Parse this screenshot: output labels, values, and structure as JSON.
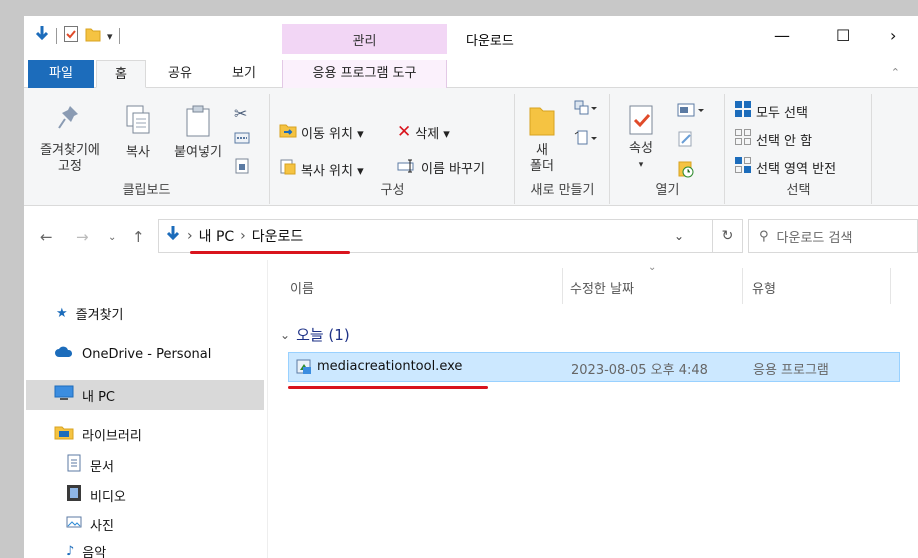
{
  "titlebar": {
    "title": "다운로드",
    "context_group": "관리",
    "minimize": "—",
    "maximize": "☐",
    "close_partial": "›"
  },
  "tabs": {
    "file": "파일",
    "home": "홈",
    "share": "공유",
    "view": "보기",
    "app_tools": "응용 프로그램 도구"
  },
  "ribbon": {
    "clipboard": {
      "pin": "즐겨찾기에\n고정",
      "copy": "복사",
      "paste": "붙여넣기",
      "label": "클립보드"
    },
    "organize": {
      "move_to": "이동 위치 ▾",
      "delete": "삭제 ▾",
      "copy_to": "복사 위치 ▾",
      "rename": "이름 바꾸기",
      "label": "구성"
    },
    "new": {
      "new_folder": "새\n폴더",
      "label": "새로 만들기"
    },
    "open": {
      "properties": "속성",
      "label": "열기"
    },
    "select": {
      "select_all": "모두 선택",
      "select_none": "선택 안 함",
      "invert": "선택 영역 반전",
      "label": "선택"
    }
  },
  "address": {
    "crumb_pc": "내 PC",
    "crumb_downloads": "다운로드",
    "sep": "›",
    "search_placeholder": "다운로드 검색"
  },
  "navpane": {
    "items": [
      {
        "label": "즐겨찾기"
      },
      {
        "label": "OneDrive - Personal"
      },
      {
        "label": "내 PC"
      },
      {
        "label": "라이브러리"
      },
      {
        "label": "문서"
      },
      {
        "label": "비디오"
      },
      {
        "label": "사진"
      },
      {
        "label": "음악"
      }
    ]
  },
  "filelist": {
    "columns": [
      "이름",
      "수정한 날짜",
      "유형"
    ],
    "group": "오늘 (1)",
    "rows": [
      {
        "name": "mediacreationtool.exe",
        "modified": "2023-08-05 오후 4:48",
        "type": "응용 프로그램"
      }
    ]
  },
  "colors": {
    "file_tab": "#1c6cbb",
    "context_tab": "#f2d6f5",
    "selection": "#cce8ff",
    "annotation": "#d9141d"
  }
}
